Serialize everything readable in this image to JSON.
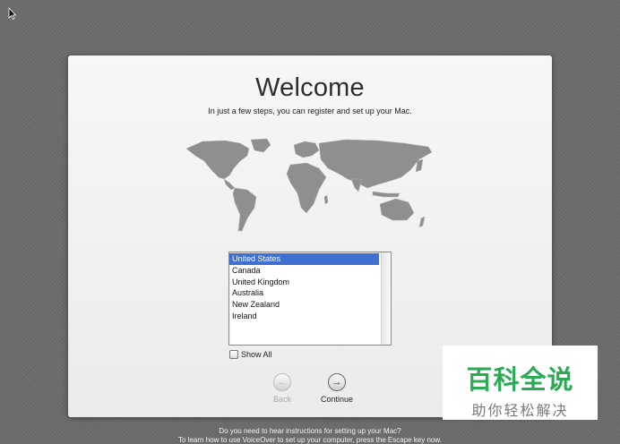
{
  "welcome": {
    "title": "Welcome",
    "subtitle": "In just a few steps, you can register and set up your Mac."
  },
  "country_list": {
    "items": [
      "United States",
      "Canada",
      "United Kingdom",
      "Australia",
      "New Zealand",
      "Ireland"
    ],
    "selected_index": 0
  },
  "show_all": {
    "label": "Show All",
    "checked": false
  },
  "buttons": {
    "back_label": "Back",
    "continue_label": "Continue"
  },
  "footer": {
    "line1": "Do you need to hear instructions for setting up your Mac?",
    "line2": "To learn how to use VoiceOver to set up your computer, press the Escape key now."
  },
  "watermark": {
    "main": "百科全说",
    "sub": "助你轻松解决"
  },
  "colors": {
    "selection": "#3f6fd1",
    "watermark_green": "#2daa56"
  },
  "icons": {
    "back": "arrow-left-icon",
    "continue": "arrow-right-icon",
    "cursor": "mouse-pointer-icon",
    "map": "world-map-icon"
  }
}
